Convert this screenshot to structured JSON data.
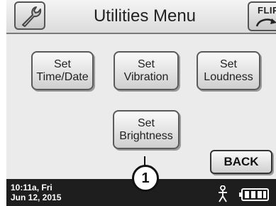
{
  "header": {
    "title": "Utilities Menu",
    "left_icon": "wrench-icon",
    "flip_label": "FLIP",
    "flip_icon": "flip-arrow-icon"
  },
  "buttons": {
    "time_date": "Set\nTime/Date",
    "vibration": "Set\nVibration",
    "loudness": "Set\nLoudness",
    "brightness": "Set\nBrightness",
    "back": "BACK"
  },
  "status_bar": {
    "time": "10:11a, Fri",
    "date": "Jun 12, 2015",
    "icons": [
      "person-icon",
      "battery-icon"
    ],
    "battery_level": 1.0
  },
  "callout": {
    "label": "1"
  },
  "colors": {
    "status_bar_bg": "#1e1e1e",
    "screen_bg": "#ebebeb"
  }
}
